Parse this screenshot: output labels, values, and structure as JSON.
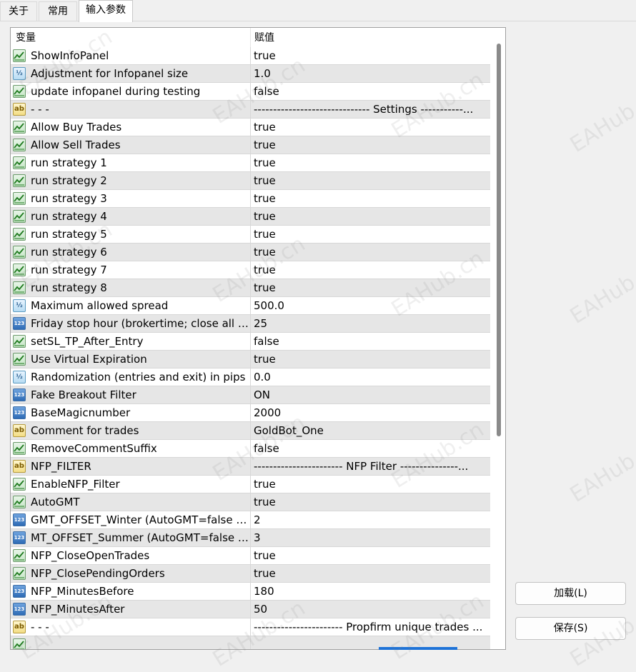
{
  "tabs": [
    "关于",
    "常用",
    "输入参数"
  ],
  "header": {
    "col_variable": "变量",
    "col_value": "赋值"
  },
  "rows": [
    {
      "icon": "bool",
      "name": "ShowInfoPanel",
      "value": "true"
    },
    {
      "icon": "double",
      "name": "Adjustment for Infopanel size",
      "value": "1.0"
    },
    {
      "icon": "bool",
      "name": "update infopanel during testing",
      "value": "false"
    },
    {
      "icon": "string",
      "name": "- - -",
      "value": "------------------------------ Settings -----------..."
    },
    {
      "icon": "bool",
      "name": "Allow Buy Trades",
      "value": "true"
    },
    {
      "icon": "bool",
      "name": "Allow Sell Trades",
      "value": "true"
    },
    {
      "icon": "bool",
      "name": "run strategy 1",
      "value": "true"
    },
    {
      "icon": "bool",
      "name": "run strategy 2",
      "value": "true"
    },
    {
      "icon": "bool",
      "name": "run strategy 3",
      "value": "true"
    },
    {
      "icon": "bool",
      "name": "run strategy 4",
      "value": "true"
    },
    {
      "icon": "bool",
      "name": "run strategy 5",
      "value": "true"
    },
    {
      "icon": "bool",
      "name": "run strategy 6",
      "value": "true"
    },
    {
      "icon": "bool",
      "name": "run strategy 7",
      "value": "true"
    },
    {
      "icon": "bool",
      "name": "run strategy 8",
      "value": "true"
    },
    {
      "icon": "double",
      "name": "Maximum allowed spread",
      "value": "500.0"
    },
    {
      "icon": "int",
      "name": "Friday stop hour (brokertime; close all t...",
      "value": "25"
    },
    {
      "icon": "bool",
      "name": "setSL_TP_After_Entry",
      "value": "false"
    },
    {
      "icon": "bool",
      "name": "Use Virtual Expiration",
      "value": "true"
    },
    {
      "icon": "double",
      "name": "Randomization (entries and exit) in pips",
      "value": "0.0"
    },
    {
      "icon": "int",
      "name": "Fake Breakout Filter",
      "value": "ON"
    },
    {
      "icon": "int",
      "name": "BaseMagicnumber",
      "value": "2000"
    },
    {
      "icon": "string",
      "name": "Comment for trades",
      "value": "GoldBot_One"
    },
    {
      "icon": "bool",
      "name": "RemoveCommentSuffix",
      "value": "false"
    },
    {
      "icon": "string",
      "name": "NFP_FILTER",
      "value": "----------------------- NFP Filter ---------------..."
    },
    {
      "icon": "bool",
      "name": "EnableNFP_Filter",
      "value": "true"
    },
    {
      "icon": "bool",
      "name": "AutoGMT",
      "value": "true"
    },
    {
      "icon": "int",
      "name": "GMT_OFFSET_Winter (AutoGMT=false o...",
      "value": "2"
    },
    {
      "icon": "int",
      "name": "MT_OFFSET_Summer (AutoGMT=false o...",
      "value": "3"
    },
    {
      "icon": "bool",
      "name": "NFP_CloseOpenTrades",
      "value": "true"
    },
    {
      "icon": "bool",
      "name": "NFP_ClosePendingOrders",
      "value": "true"
    },
    {
      "icon": "int",
      "name": "NFP_MinutesBefore",
      "value": "180"
    },
    {
      "icon": "int",
      "name": "NFP_MinutesAfter",
      "value": "50"
    },
    {
      "icon": "string",
      "name": "- - -",
      "value": "----------------------- Propfirm unique trades ..."
    },
    {
      "icon": "bool",
      "name": "",
      "value": ""
    }
  ],
  "icon_labels": {
    "double": "½",
    "int": "123",
    "string": "ab"
  },
  "buttons": {
    "load": "加载(L)",
    "save": "保存(S)"
  },
  "watermark": "EAHub.cn"
}
